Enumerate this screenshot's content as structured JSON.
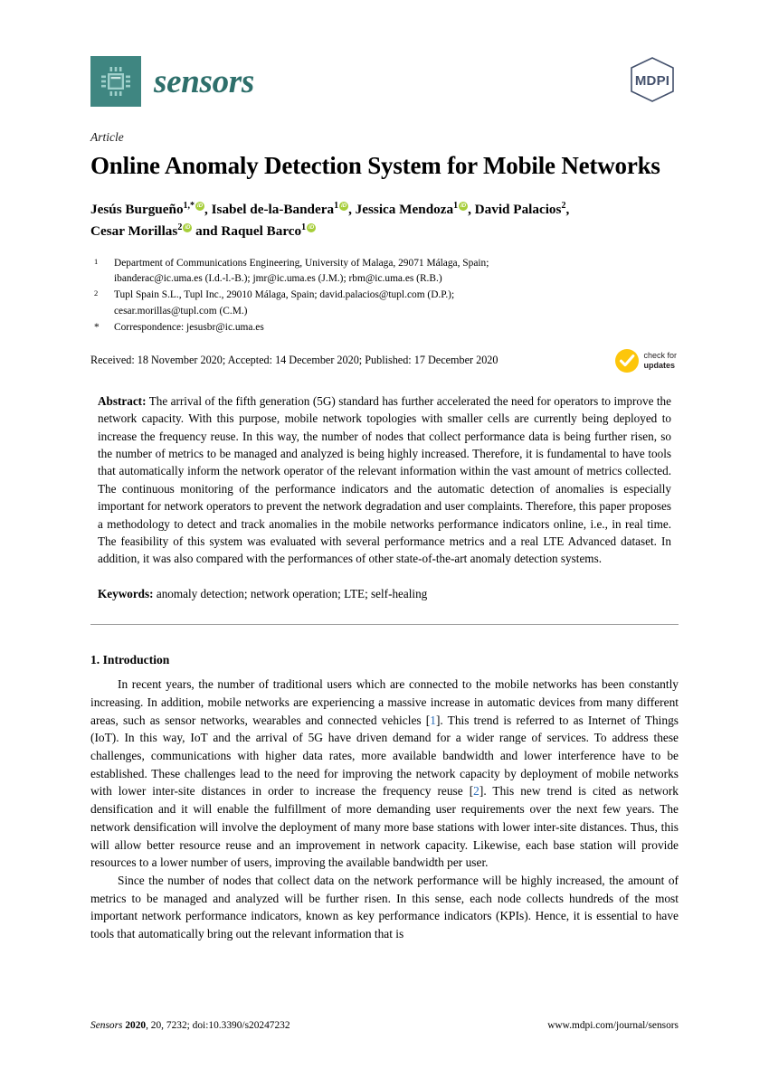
{
  "journal": {
    "name": "sensors",
    "logo_icon": "microchip-icon",
    "publisher_logo_text": "MDPI",
    "brand_color": "#3f8681",
    "name_color": "#2e6f6b",
    "mdpi_color": "#43506c"
  },
  "article": {
    "kind": "Article",
    "title": "Online Anomaly Detection System for Mobile Networks"
  },
  "authors": {
    "line1_parts": [
      {
        "name": "Jesús Burgueño",
        "sup": "1,*",
        "orcid": true,
        "sep": ", "
      },
      {
        "name": "Isabel de-la-Bandera",
        "sup": "1",
        "orcid": true,
        "sep": ", "
      },
      {
        "name": "Jessica Mendoza",
        "sup": "1",
        "orcid": true,
        "sep": ", "
      },
      {
        "name": "David Palacios",
        "sup": "2",
        "orcid": false,
        "sep": ","
      }
    ],
    "line2_parts": [
      {
        "name": "Cesar Morillas",
        "sup": "2",
        "orcid": true,
        "sep": " and "
      },
      {
        "name": "Raquel Barco",
        "sup": "1",
        "orcid": true,
        "sep": ""
      }
    ]
  },
  "affiliations": [
    {
      "marker": "1",
      "lines": [
        "Department of Communications Engineering, University of Malaga, 29071 Málaga, Spain;",
        "ibanderac@ic.uma.es (I.d.-l.-B.); jmr@ic.uma.es (J.M.); rbm@ic.uma.es (R.B.)"
      ]
    },
    {
      "marker": "2",
      "lines": [
        "Tupl Spain S.L., Tupl Inc., 29010 Málaga, Spain; david.palacios@tupl.com (D.P.);",
        "cesar.morillas@tupl.com (C.M.)"
      ]
    },
    {
      "marker": "*",
      "lines": [
        "Correspondence: jesusbr@ic.uma.es"
      ]
    }
  ],
  "dates": {
    "line": "Received: 18 November 2020; Accepted: 14 December 2020; Published: 17 December 2020",
    "badge": {
      "line1": "check for",
      "line2": "updates",
      "color": "#fdc60b",
      "icon": "check-mark-icon"
    }
  },
  "abstract": {
    "label": "Abstract:",
    "text": "The arrival of the fifth generation (5G) standard has further accelerated the need for operators to improve the network capacity. With this purpose, mobile network topologies with smaller cells are currently being deployed to increase the frequency reuse. In this way, the number of nodes that collect performance data is being further risen, so the number of metrics to be managed and analyzed is being highly increased. Therefore, it is fundamental to have tools that automatically inform the network operator of the relevant information within the vast amount of metrics collected. The continuous monitoring of the performance indicators and the automatic detection of anomalies is especially important for network operators to prevent the network degradation and user complaints. Therefore, this paper proposes a methodology to detect and track anomalies in the mobile networks performance indicators online, i.e., in real time. The feasibility of this system was evaluated with several performance metrics and a real LTE Advanced dataset. In addition, it was also compared with the performances of other state-of-the-art anomaly detection systems."
  },
  "keywords": {
    "label": "Keywords:",
    "text": "anomaly detection; network operation; LTE; self-healing"
  },
  "section": {
    "heading": "1. Introduction",
    "paragraph1_a": "In recent years, the number of traditional users which are connected to the mobile networks has been constantly increasing. In addition, mobile networks are experiencing a massive increase in automatic devices from many different areas, such as sensor networks, wearables and connected vehicles [",
    "paragraph1_cite1": "1",
    "paragraph1_b": "]. This trend is referred to as Internet of Things (IoT). In this way, IoT and the arrival of 5G have driven demand for a wider range of services. To address these challenges, communications with higher data rates, more available bandwidth and lower interference have to be established. These challenges lead to the need for improving the network capacity by deployment of mobile networks with lower inter-site distances in order to increase the frequency reuse [",
    "paragraph1_cite2": "2",
    "paragraph1_c": "]. This new trend is cited as network densification and it will enable the fulfillment of more demanding user requirements over the next few years. The network densification will involve the deployment of many more base stations with lower inter-site distances. Thus, this will allow better resource reuse and an improvement in network capacity. Likewise, each base station will provide resources to a lower number of users, improving the available bandwidth per user.",
    "paragraph2": "Since the number of nodes that collect data on the network performance will be highly increased, the amount of metrics to be managed and analyzed will be further risen. In this sense, each node collects hundreds of the most important network performance indicators, known as key performance indicators (KPIs). Hence, it is essential to have tools that automatically bring out the relevant information that is"
  },
  "footer": {
    "journal_italic": "Sensors",
    "year": "2020",
    "volume_page": ", 20, 7232; doi:10.3390/s20247232",
    "url": "www.mdpi.com/journal/sensors"
  }
}
